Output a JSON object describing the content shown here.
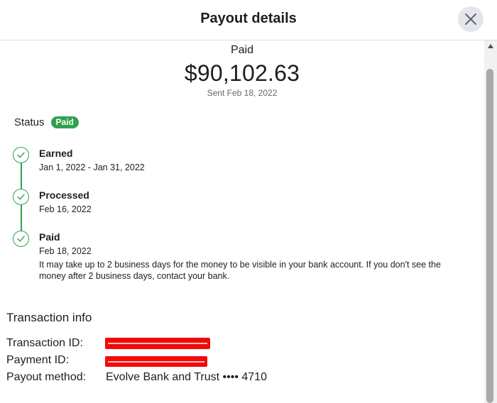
{
  "header": {
    "title": "Payout details",
    "close_icon": "close-icon"
  },
  "summary": {
    "status": "Paid",
    "amount": "$90,102.63",
    "sent": "Sent Feb 18, 2022"
  },
  "status": {
    "label": "Status",
    "badge": "Paid",
    "badge_color": "#31a24c"
  },
  "timeline": {
    "color": "#31a24c",
    "steps": [
      {
        "title": "Earned",
        "date": "Jan 1, 2022 - Jan 31, 2022",
        "icon": "check-icon"
      },
      {
        "title": "Processed",
        "date": "Feb 16, 2022",
        "icon": "check-icon"
      },
      {
        "title": "Paid",
        "date": "Feb 18, 2022",
        "icon": "check-icon",
        "note": "It may take up to 2 business days for the money to be visible in your bank account. If you don't see the money after 2 business days, contact your bank."
      }
    ]
  },
  "transaction": {
    "title": "Transaction info",
    "rows": [
      {
        "label": "Transaction ID:",
        "redacted": true
      },
      {
        "label": "Payment ID:",
        "redacted": true
      },
      {
        "label": "Payout method:",
        "value": "Evolve Bank and Trust •••• 4710"
      }
    ],
    "redaction_color": "#f10a0a"
  }
}
